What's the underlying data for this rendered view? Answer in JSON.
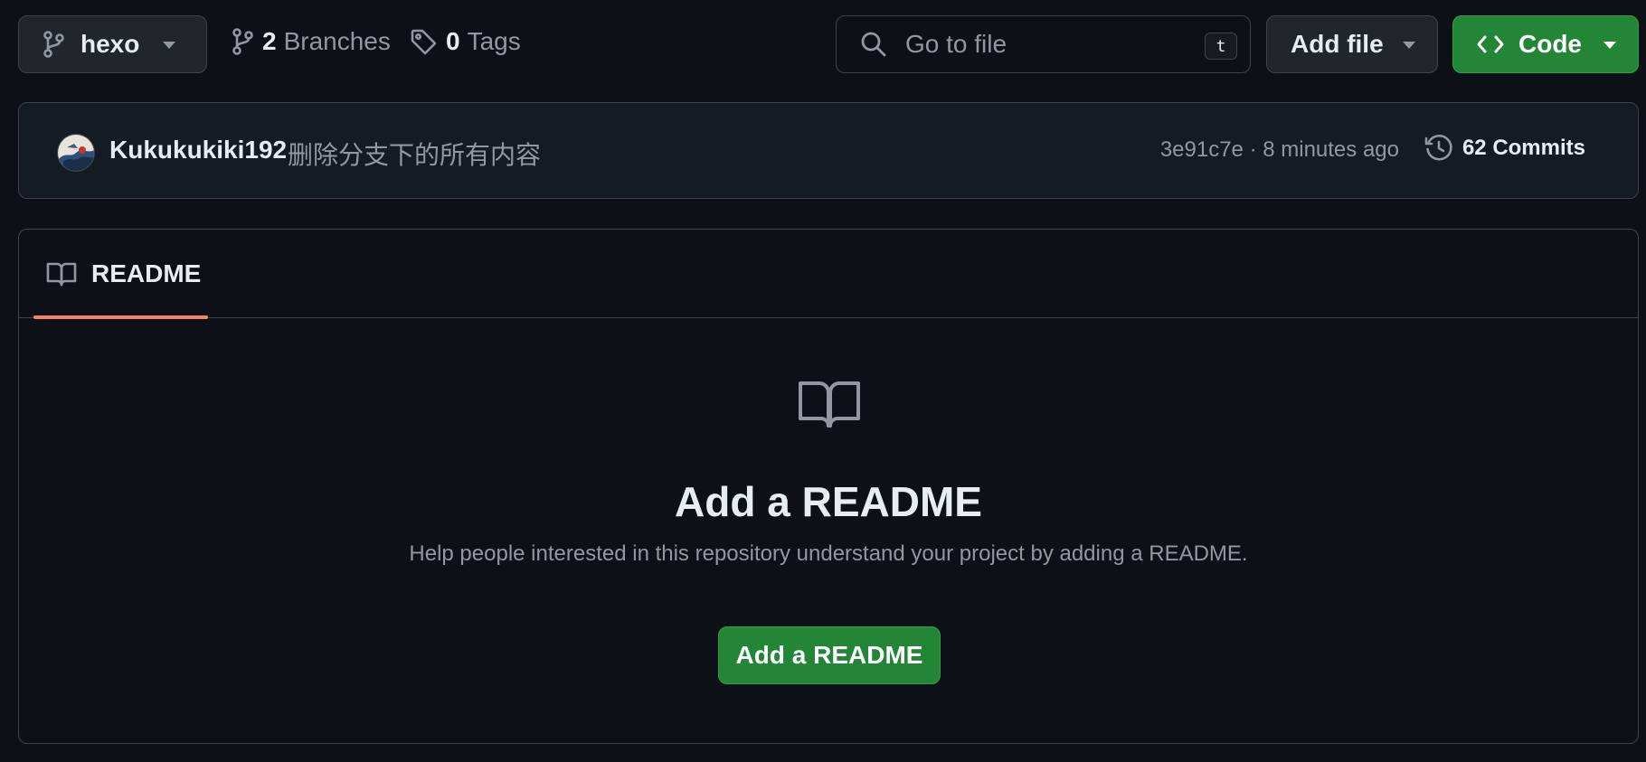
{
  "toolbar": {
    "branch_name": "hexo",
    "branches_count": "2",
    "branches_label": "Branches",
    "tags_count": "0",
    "tags_label": "Tags",
    "search_placeholder": "Go to file",
    "search_shortcut": "t",
    "add_file_label": "Add file",
    "code_label": "Code"
  },
  "commit": {
    "author": "Kukukukiki192",
    "message": "删除分支下的所有内容",
    "sha_time": "3e91c7e · 8 minutes ago",
    "commits_label": "62 Commits"
  },
  "readme": {
    "tab_label": "README",
    "empty_title": "Add a README",
    "empty_description": "Help people interested in this repository understand your project by adding a README.",
    "add_button_label": "Add a README"
  },
  "colors": {
    "background": "#0d1117",
    "primary_green": "#238636",
    "tab_underline": "#f78166",
    "muted_text": "#9198a1"
  },
  "icons": [
    "git-branch-icon",
    "chevron-down-icon",
    "tag-icon",
    "search-icon",
    "code-icon",
    "history-icon",
    "book-icon"
  ]
}
